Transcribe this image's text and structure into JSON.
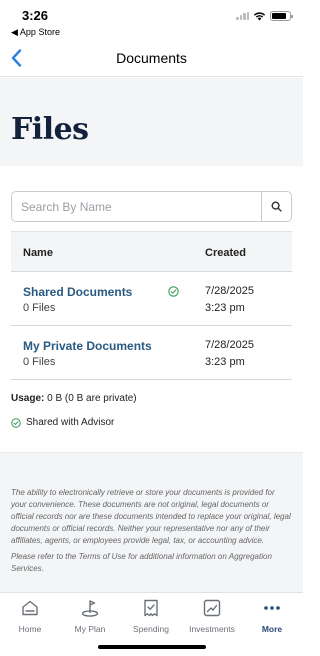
{
  "status_bar": {
    "time": "3:26",
    "back_app": "◀ App Store"
  },
  "header": {
    "title": "Documents"
  },
  "hero": {
    "title": "Files"
  },
  "search": {
    "placeholder": "Search By Name"
  },
  "table": {
    "headers": {
      "name": "Name",
      "created": "Created"
    },
    "rows": [
      {
        "name": "Shared Documents",
        "count": "0 Files",
        "date": "7/28/2025",
        "time": "3:23 pm",
        "shared": true
      },
      {
        "name": "My Private Documents",
        "count": "0 Files",
        "date": "7/28/2025",
        "time": "3:23 pm",
        "shared": false
      }
    ]
  },
  "usage": {
    "label": "Usage:",
    "value": "0 B (0 B are private)"
  },
  "legend": {
    "label": "Shared with Advisor"
  },
  "disclaimer": {
    "paragraph1": "The ability to electronically retrieve or store your documents is provided for your convenience. These documents are not original, legal documents or official records nor are these documents intended to replace your original, legal documents or official records. Neither your representative nor any of their affiliates, agents, or employees provide legal, tax, or accounting advice.",
    "paragraph2": "Please refer to the Terms of Use for additional information on Aggregation Services."
  },
  "tabs": [
    {
      "label": "Home",
      "icon": "home-icon"
    },
    {
      "label": "My Plan",
      "icon": "plan-icon"
    },
    {
      "label": "Spending",
      "icon": "spending-icon"
    },
    {
      "label": "Investments",
      "icon": "investments-icon"
    },
    {
      "label": "More",
      "icon": "more-icon",
      "active": true
    }
  ],
  "colors": {
    "accent": "#2a5a82",
    "hero_title": "#14213d",
    "shared_check": "#3a9a5b",
    "back_arrow": "#2f7fe0"
  }
}
